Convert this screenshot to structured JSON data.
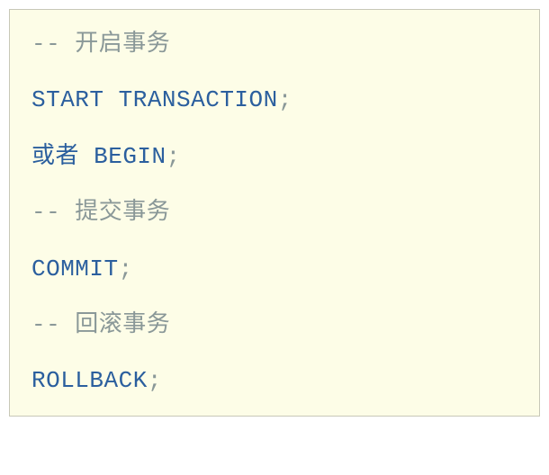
{
  "code": {
    "lines": [
      {
        "type": "comment",
        "text": "-- 开启事务"
      },
      {
        "type": "statement",
        "keyword": "START TRANSACTION",
        "punct": ";"
      },
      {
        "type": "mixed",
        "prefix": "或者  ",
        "keyword": "BEGIN",
        "punct": ";"
      },
      {
        "type": "comment",
        "text": "-- 提交事务"
      },
      {
        "type": "statement",
        "keyword": "COMMIT",
        "punct": ";"
      },
      {
        "type": "comment",
        "text": "-- 回滚事务"
      },
      {
        "type": "statement",
        "keyword": "ROLLBACK",
        "punct": ";"
      }
    ]
  }
}
